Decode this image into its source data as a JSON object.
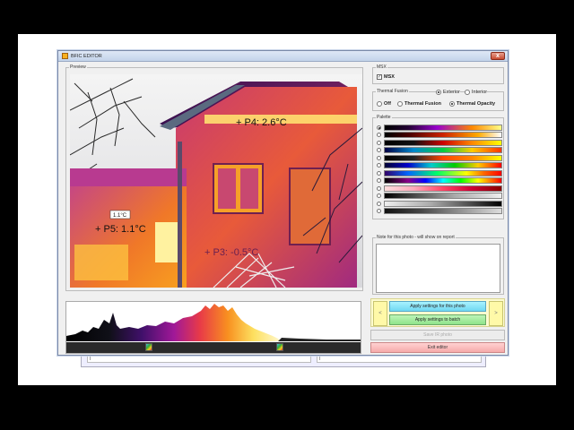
{
  "window": {
    "title": "BFIC EDITOR",
    "close_glyph": "x"
  },
  "preview": {
    "label": "Preview",
    "markers": [
      {
        "id": "P4",
        "text": "+ P4: 2.6°C"
      },
      {
        "id": "P5",
        "text": "+ P5: 1.1°C"
      },
      {
        "id": "P3",
        "text": "+ P3: -0.5°C"
      }
    ],
    "small_tag": "1.1°C"
  },
  "msx": {
    "group_label": "MSX",
    "checkbox_label": "MSX",
    "checked": true
  },
  "thermal_fusion": {
    "group_label": "Thermal Fusion",
    "exterior_label": "Exterior",
    "interior_label": "Interior",
    "off_label": "Off",
    "fusion_label": "Thermal Fusion",
    "opacity_label": "Thermal Opacity",
    "selected_mode": "Thermal Opacity",
    "selected_env": "Exterior"
  },
  "palette": {
    "group_label": "Palette",
    "swatches": [
      "linear-gradient(90deg,#000,#203 20%,#90c 45%,#f80 75%,#ff8 100%)",
      "linear-gradient(90deg,#000,#400 20%,#c20 50%,#fa0 80%,#fff 100%)",
      "linear-gradient(90deg,#000,#111 25%,#c00 50%,#f80 75%,#ff0 100%)",
      "linear-gradient(90deg,#004,#08c 25%,#0c4 50%,#fc0 75%,#f30 100%)",
      "linear-gradient(90deg,#000,#222 25%,#f40 50%,#f80 75%,#ff0 100%)",
      "linear-gradient(90deg,#003,#00c 20%,#0cc 40%,#0c0 60%,#fc0 80%,#f00 100%)",
      "linear-gradient(90deg,#306,#06f 20%,#0f6 45%,#ff0 70%,#f60 85%,#f00 100%)",
      "linear-gradient(90deg,#000,#808 20%,#00f 35%,#0ff 50%,#0f0 65%,#ff0 80%,#f00 100%)",
      "linear-gradient(90deg,#fdd,#fab 25%,#f46 50%,#c03 75%,#800 100%)",
      "linear-gradient(90deg,#000,#555 30%,#aaa 60%,#eee 100%)",
      "linear-gradient(90deg,#eee,#aaa 40%,#555 70%,#000 100%)",
      "linear-gradient(90deg,#111,#444 30%,#888 60%,#ddd 100%)"
    ],
    "selected_index": 0
  },
  "note": {
    "group_label": "Note for this photo - will show on report"
  },
  "buttons": {
    "prev_glyph": "<",
    "next_glyph": ">",
    "apply_photo": "Apply settings for this photo",
    "apply_batch": "Apply settings to batch",
    "save_ir": "Save IR photo",
    "exit": "Exit editor"
  },
  "background_window": {
    "left_glyph": "|",
    "right_glyph": "|"
  },
  "colors": {
    "accent_cyan": "#70d8f2",
    "accent_green": "#8fe38a",
    "exit_red": "#f6aaaa"
  }
}
